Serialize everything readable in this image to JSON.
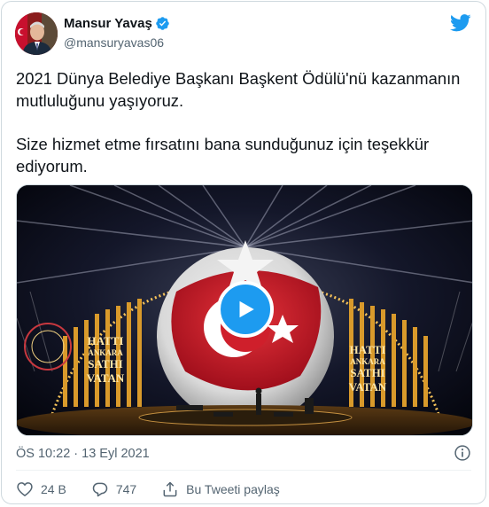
{
  "author": {
    "name": "Mansur Yavaş",
    "handle": "@mansuryavas06"
  },
  "tweet": {
    "paragraph1": "2021 Dünya Belediye Başkanı Başkent Ödülü'nü kazanmanın mutluluğunu yaşıyoruz.",
    "paragraph2": "Size hizmet etme fırsatını bana sunduğunuz için teşekkür ediyorum."
  },
  "media": {
    "stage_sign_left": [
      "HATTI",
      "ANKARA",
      "SATHI",
      "VATAN"
    ],
    "stage_sign_right": [
      "HATTI",
      "ANKARA",
      "SATHI",
      "VATAN"
    ]
  },
  "timestamp": "ÖS 10:22 · 13 Eyl 2021",
  "actions": {
    "likes": "24 B",
    "replies": "747",
    "share_label": "Bu Tweeti paylaş"
  },
  "colors": {
    "accent": "#1d9bf0",
    "text": "#0f1419",
    "muted": "#536471",
    "border": "#cfd9de"
  },
  "icons": [
    "verified-badge-icon",
    "twitter-bird-icon",
    "play-icon",
    "info-icon",
    "heart-icon",
    "reply-icon",
    "share-icon"
  ]
}
